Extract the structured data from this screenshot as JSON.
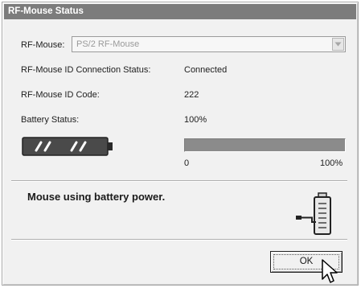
{
  "window": {
    "title": "RF-Mouse Status"
  },
  "fields": {
    "rf_mouse_label": "RF-Mouse:",
    "rf_mouse_value": "PS/2 RF-Mouse",
    "connection_label": "RF-Mouse ID Connection Status:",
    "connection_value": "Connected",
    "id_code_label": "RF-Mouse ID Code:",
    "id_code_value": "222",
    "battery_label": "Battery Status:",
    "battery_value": "100%"
  },
  "battery_gauge": {
    "level_fraction": 1.0,
    "min_label": "0",
    "max_label": "100%"
  },
  "message": "Mouse using battery power.",
  "buttons": {
    "ok_label": "OK"
  },
  "icons": {
    "battery": "battery-icon",
    "power_plug": "battery-plug-icon",
    "cursor": "mouse-cursor-icon",
    "dropdown": "chevron-down-icon"
  },
  "colors": {
    "title_bar": "#7c7c7c",
    "dialog_bg": "#f1f1f1",
    "progress_fill": "#8b8b8b"
  }
}
